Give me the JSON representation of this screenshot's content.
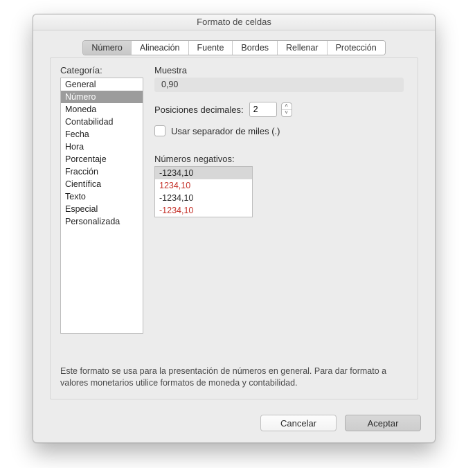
{
  "window": {
    "title": "Formato de celdas"
  },
  "tabs": {
    "items": [
      "Número",
      "Alineación",
      "Fuente",
      "Bordes",
      "Rellenar",
      "Protección"
    ],
    "active_index": 0
  },
  "left": {
    "label": "Categoría:",
    "categories": [
      "General",
      "Número",
      "Moneda",
      "Contabilidad",
      "Fecha",
      "Hora",
      "Porcentaje",
      "Fracción",
      "Científica",
      "Texto",
      "Especial",
      "Personalizada"
    ],
    "selected_index": 1
  },
  "right": {
    "sample_label": "Muestra",
    "sample_value": "0,90",
    "decimals_label": "Posiciones decimales:",
    "decimals_value": "2",
    "thousands_label": "Usar separador de miles (.)",
    "thousands_checked": false,
    "negatives_label": "Números negativos:",
    "negatives": [
      {
        "text": "-1234,10",
        "red": false
      },
      {
        "text": "1234,10",
        "red": true
      },
      {
        "text": "-1234,10",
        "red": false
      },
      {
        "text": "-1234,10",
        "red": true
      }
    ],
    "negatives_selected_index": 0
  },
  "description": "Este formato se usa para la presentación de números en general. Para dar formato a valores monetarios utilice formatos de moneda y contabilidad.",
  "footer": {
    "cancel": "Cancelar",
    "ok": "Aceptar"
  }
}
